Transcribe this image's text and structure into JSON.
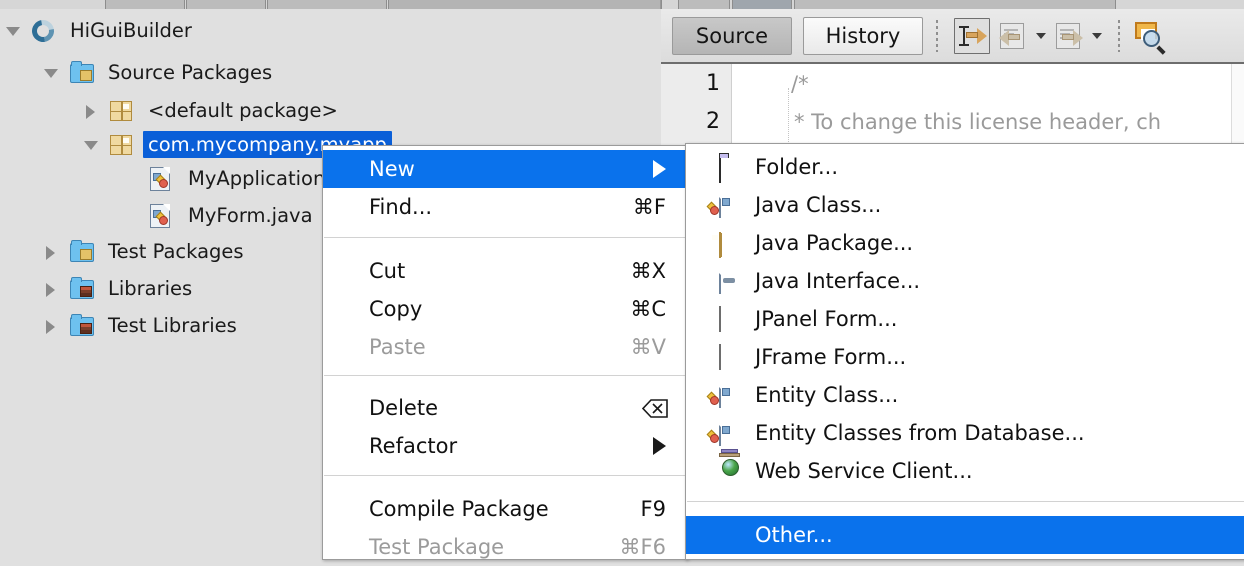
{
  "window": {
    "toolbar_strip": "partial-toolbar"
  },
  "tree": {
    "items": [
      {
        "label": "HiGuiBuilder",
        "icon": "project-icon",
        "twisty": "down",
        "depth": 0,
        "selected": false
      },
      {
        "label": "Source Packages",
        "icon": "source-packages-folder-icon",
        "twisty": "down",
        "depth": 1,
        "selected": false
      },
      {
        "label": "<default package>",
        "icon": "java-package-icon",
        "twisty": "right",
        "depth": 2,
        "selected": false
      },
      {
        "label": "com.mycompany.myapp",
        "icon": "java-package-icon",
        "twisty": "down",
        "depth": 2,
        "selected": true
      },
      {
        "label": "MyApplication.java",
        "icon": "java-file-icon",
        "twisty": "none",
        "depth": 3,
        "selected": false
      },
      {
        "label": "MyForm.java",
        "icon": "java-file-icon",
        "twisty": "none",
        "depth": 3,
        "selected": false
      },
      {
        "label": "Test Packages",
        "icon": "test-packages-folder-icon",
        "twisty": "right",
        "depth": 1,
        "selected": false
      },
      {
        "label": "Libraries",
        "icon": "libraries-folder-icon",
        "twisty": "right",
        "depth": 1,
        "selected": false
      },
      {
        "label": "Test Libraries",
        "icon": "test-libraries-folder-icon",
        "twisty": "right",
        "depth": 1,
        "selected": false
      }
    ]
  },
  "editor": {
    "tabs": [
      {
        "label": "Source",
        "active": true
      },
      {
        "label": "History",
        "active": false
      }
    ],
    "toolbar_icons": [
      "last-edit-position-icon",
      "back-icon",
      "back-dropdown-icon",
      "forward-icon",
      "forward-dropdown-icon",
      "find-selection-icon"
    ],
    "lines": [
      {
        "number": "1",
        "text": "/*"
      },
      {
        "number": "2",
        "text": "* To change this license header, ch"
      }
    ]
  },
  "context_menu": {
    "items": [
      {
        "label": "New",
        "shortcut": "",
        "selected": true,
        "disabled": false,
        "submenu": true
      },
      {
        "label": "Find...",
        "shortcut": "⌘F",
        "selected": false,
        "disabled": false,
        "submenu": false
      },
      {
        "separator": true
      },
      {
        "label": "Cut",
        "shortcut": "⌘X",
        "selected": false,
        "disabled": false,
        "submenu": false
      },
      {
        "label": "Copy",
        "shortcut": "⌘C",
        "selected": false,
        "disabled": false,
        "submenu": false
      },
      {
        "label": "Paste",
        "shortcut": "⌘V",
        "selected": false,
        "disabled": true,
        "submenu": false
      },
      {
        "separator": true
      },
      {
        "label": "Delete",
        "shortcut": "delete-key-icon",
        "selected": false,
        "disabled": false,
        "submenu": false
      },
      {
        "label": "Refactor",
        "shortcut": "",
        "selected": false,
        "disabled": false,
        "submenu": true
      },
      {
        "separator": true
      },
      {
        "label": "Compile Package",
        "shortcut": "F9",
        "selected": false,
        "disabled": false,
        "submenu": false
      },
      {
        "label": "Test Package",
        "shortcut": "⌘F6",
        "selected": false,
        "disabled": true,
        "submenu": false
      }
    ]
  },
  "new_submenu": {
    "items": [
      {
        "label": "Folder...",
        "icon": "folder-icon",
        "selected": false
      },
      {
        "label": "Java Class...",
        "icon": "java-class-icon",
        "selected": false
      },
      {
        "label": "Java Package...",
        "icon": "java-package-icon",
        "selected": false
      },
      {
        "label": "Java Interface...",
        "icon": "java-interface-icon",
        "selected": false
      },
      {
        "label": "JPanel Form...",
        "icon": "jpanel-form-icon",
        "selected": false
      },
      {
        "label": "JFrame Form...",
        "icon": "jframe-form-icon",
        "selected": false
      },
      {
        "label": "Entity Class...",
        "icon": "entity-class-icon",
        "selected": false
      },
      {
        "label": "Entity Classes from Database...",
        "icon": "entity-classes-db-icon",
        "selected": false
      },
      {
        "label": "Web Service Client...",
        "icon": "web-service-client-icon",
        "selected": false
      },
      {
        "separator": true
      },
      {
        "label": "Other...",
        "icon": "",
        "selected": true
      }
    ]
  },
  "colors": {
    "selection_blue": "#0a5fd8",
    "menu_highlight_blue": "#0a72ec",
    "panel_bg": "#e0e0e0",
    "menu_bg": "#ffffff"
  }
}
